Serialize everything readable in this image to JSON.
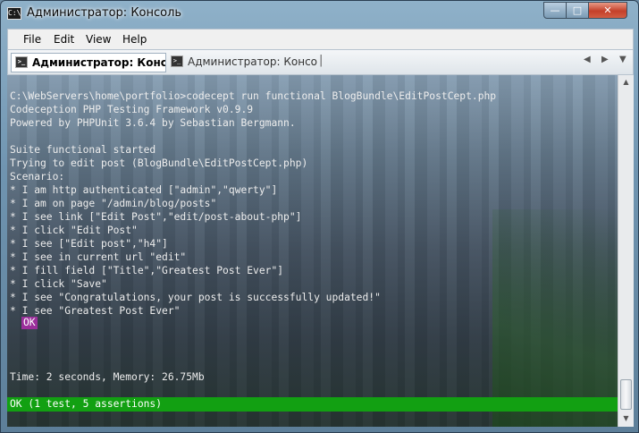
{
  "window": {
    "title": "Администратор: Консоль",
    "controls": {
      "minimize": "—",
      "maximize": "□",
      "close": "✕"
    }
  },
  "menu": [
    "File",
    "Edit",
    "View",
    "Help"
  ],
  "tabs": [
    {
      "label": "Администратор: Консо...",
      "active": true
    },
    {
      "label": "Администратор: Консо...",
      "active": false
    }
  ],
  "tab_controls": {
    "separator": "|",
    "scroll_left": "◀",
    "scroll_right": "▶",
    "dropdown": "▼"
  },
  "console": {
    "lines": [
      "C:\\WebServers\\home\\portfolio>codecept run functional BlogBundle\\EditPostCept.php",
      "Codeception PHP Testing Framework v0.9.9",
      "Powered by PHPUnit 3.6.4 by Sebastian Bergmann.",
      "",
      "Suite functional started",
      "Trying to edit post (BlogBundle\\EditPostCept.php)",
      "Scenario:",
      "* I am http authenticated [\"admin\",\"qwerty\"]",
      "* I am on page \"/admin/blog/posts\"",
      "* I see link [\"Edit Post\",\"edit/post-about-php\"]",
      "* I click \"Edit Post\"",
      "* I see [\"Edit post\",\"h4\"]",
      "* I see in current url \"edit\"",
      "* I fill field [\"Title\",\"Greatest Post Ever\"]",
      "* I click \"Save\"",
      "* I see \"Congratulations, your post is successfully updated!\"",
      "* I see \"Greatest Post Ever\""
    ],
    "ok_badge": "OK",
    "time_line": "Time: 2 seconds, Memory: 26.75Mb",
    "result": "OK (1 test, 5 assertions)",
    "result_color": "#12a012",
    "badge_color": "#9b2f9b"
  },
  "scrollbar": {
    "up": "▲",
    "down": "▼"
  }
}
